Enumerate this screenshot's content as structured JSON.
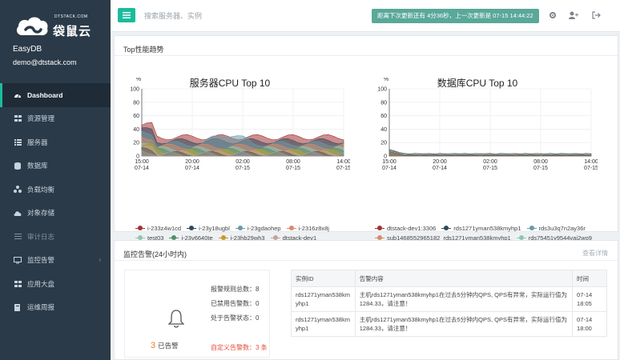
{
  "brand": {
    "small": "DTSTACK.COM",
    "name": "袋鼠云"
  },
  "user": {
    "app": "EasyDB",
    "email": "demo@dtstack.com"
  },
  "nav": [
    {
      "label": "Dashboard",
      "icon": "dashboard-icon",
      "active": true
    },
    {
      "label": "资源管理",
      "icon": "grid-icon"
    },
    {
      "label": "服务器",
      "icon": "list-icon"
    },
    {
      "label": "数据库",
      "icon": "database-icon"
    },
    {
      "label": "负载均衡",
      "icon": "sitemap-icon"
    },
    {
      "label": "对象存储",
      "icon": "cloud-icon"
    },
    {
      "label": "审计日志",
      "icon": "lines-icon"
    },
    {
      "label": "监控告警",
      "icon": "monitor-icon"
    },
    {
      "label": "应用大盘",
      "icon": "grid-icon"
    },
    {
      "label": "运维周报",
      "icon": "book-icon"
    }
  ],
  "topbar": {
    "search_placeholder": "搜索服务器、实例",
    "update_status": "距离下次更新还有 4分36秒，上一次更新是 07-15 14:44:22"
  },
  "performance": {
    "title": "Top性能趋势",
    "server_chart": {
      "title": "服务器CPU Top 10",
      "unit": "%",
      "y_ticks": [
        "0",
        "20",
        "40",
        "60",
        "80",
        "100"
      ],
      "x_ticks": [
        [
          "15:00",
          "07-14"
        ],
        [
          "20:00",
          "07-14"
        ],
        [
          "02:00",
          "07-15"
        ],
        [
          "08:00",
          "07-15"
        ],
        [
          "14:00",
          "07-15"
        ]
      ],
      "legend": [
        {
          "name": "i-233z4w1cd",
          "color": "#a33232"
        },
        {
          "name": "i-23y18ugbl",
          "color": "#2e4a5c"
        },
        {
          "name": "i-23gdaohep",
          "color": "#6a9aa6"
        },
        {
          "name": "i-2316z8x8j",
          "color": "#d98a6a"
        },
        {
          "name": "test03",
          "color": "#8fc7ae"
        },
        {
          "name": "i-23v6640te",
          "color": "#4f8f6a"
        },
        {
          "name": "i-23hb29wh3",
          "color": "#c79a2c"
        },
        {
          "name": "dtstack-dev1",
          "color": "#c5a39b"
        },
        {
          "name": "test04",
          "color": "#555555"
        },
        {
          "name": "i-23iqfr1sz",
          "color": "#9a9a9a"
        }
      ]
    },
    "db_chart": {
      "title": "数据库CPU Top 10",
      "unit": "%",
      "y_ticks": [
        "0",
        "20",
        "40",
        "60",
        "80",
        "100"
      ],
      "x_ticks": [
        [
          "15:00",
          "07-14"
        ],
        [
          "20:00",
          "07-14"
        ],
        [
          "02:00",
          "07-15"
        ],
        [
          "08:00",
          "07-15"
        ],
        [
          "14:00",
          "07-15"
        ]
      ],
      "legend": [
        {
          "name": "dtstack-dev1:3306",
          "color": "#a33232"
        },
        {
          "name": "rds1271yman538kmyhp1",
          "color": "#2e4a5c"
        },
        {
          "name": "rds3u3q7n2ay36r",
          "color": "#6a9aa6"
        },
        {
          "name": "sub1468552965182_rds1271yman538kmyhp1",
          "color": "#d98a6a"
        },
        {
          "name": "rds75451y9544vai2wo9",
          "color": "#8fc7ae"
        },
        {
          "name": "test04:3307",
          "color": "#4f8f6a"
        },
        {
          "name": "test03:orcl",
          "color": "#c79a2c"
        },
        {
          "name": "test03:3307",
          "color": "#c5a39b"
        },
        {
          "name": "test03:3306",
          "color": "#555555"
        }
      ]
    }
  },
  "alerts": {
    "title": "监控告警(24小时内)",
    "detail_link": "查看详情",
    "alarm_count": "3",
    "alarm_label": "已告警",
    "stats": [
      "报警规则总数：8",
      "已禁用告警数：0",
      "处于告警状态：0",
      "自定义告警数：3 条"
    ],
    "table": {
      "headers": [
        "实例ID",
        "告警内容",
        "时间"
      ],
      "rows": [
        [
          "rds1271yman538kmyhp1",
          "主机rds1271yman538kmyhp1在过去5分钟内QPS, QPS有异常，实际运行值为1284.33，请注意！",
          "07-14 18:05"
        ],
        [
          "rds1271yman538kmyhp1",
          "主机rds1271yman538kmyhp1在过去5分钟内QPS, QPS有异常，实际运行值为1284.33，请注意！",
          "07-14 18:00"
        ]
      ]
    }
  }
}
